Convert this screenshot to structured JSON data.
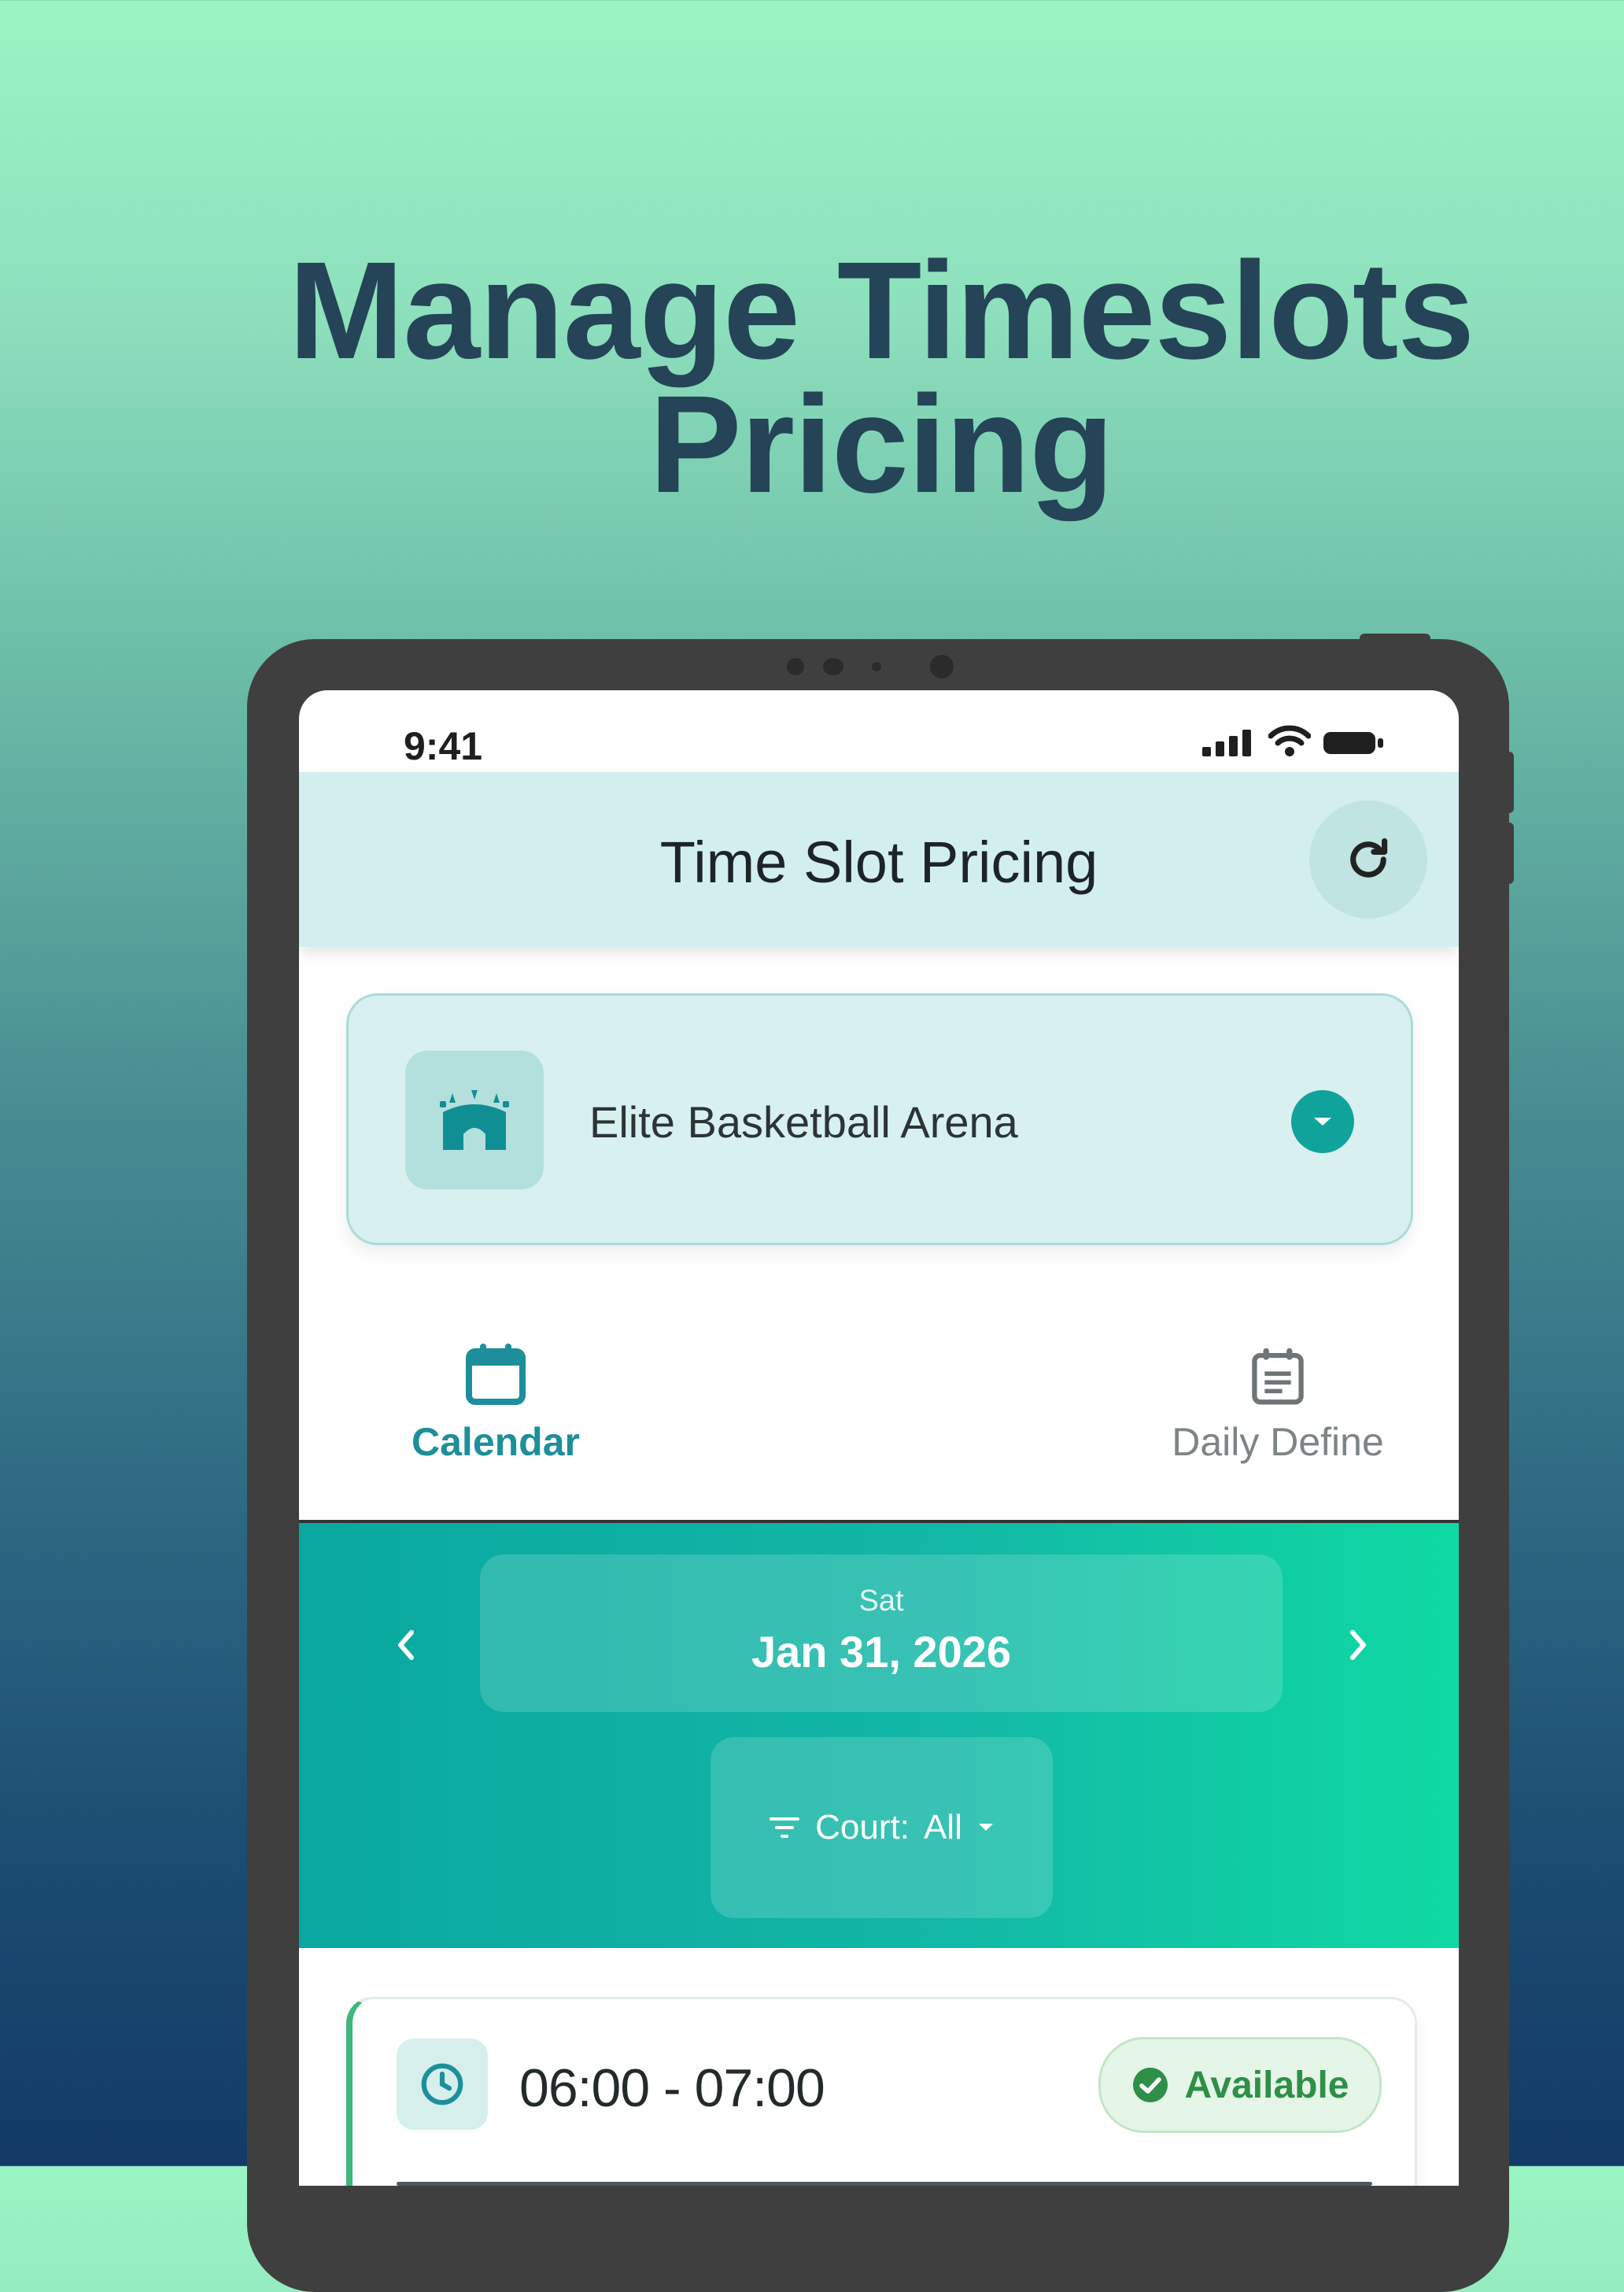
{
  "headline": {
    "line1": "Manage Timeslots",
    "line2": "Pricing"
  },
  "status_bar": {
    "time": "9:41"
  },
  "app_bar": {
    "title": "Time Slot Pricing"
  },
  "venue_selector": {
    "name": "Elite Basketball Arena"
  },
  "tabs": [
    {
      "label": "Calendar",
      "active": true,
      "icon": "calendar-icon"
    },
    {
      "label": "Daily Define",
      "active": false,
      "icon": "daily-define-icon"
    }
  ],
  "date_nav": {
    "day": "Sat",
    "date": "Jan 31, 2026"
  },
  "court_filter": {
    "label": "Court:",
    "value": "All"
  },
  "slots": [
    {
      "time": "06:00 - 07:00",
      "status": "Available"
    }
  ],
  "colors": {
    "accent": "#0fa39b",
    "tab_active": "#1d8f9b",
    "available": "#2e8f47",
    "headline": "#254457"
  }
}
